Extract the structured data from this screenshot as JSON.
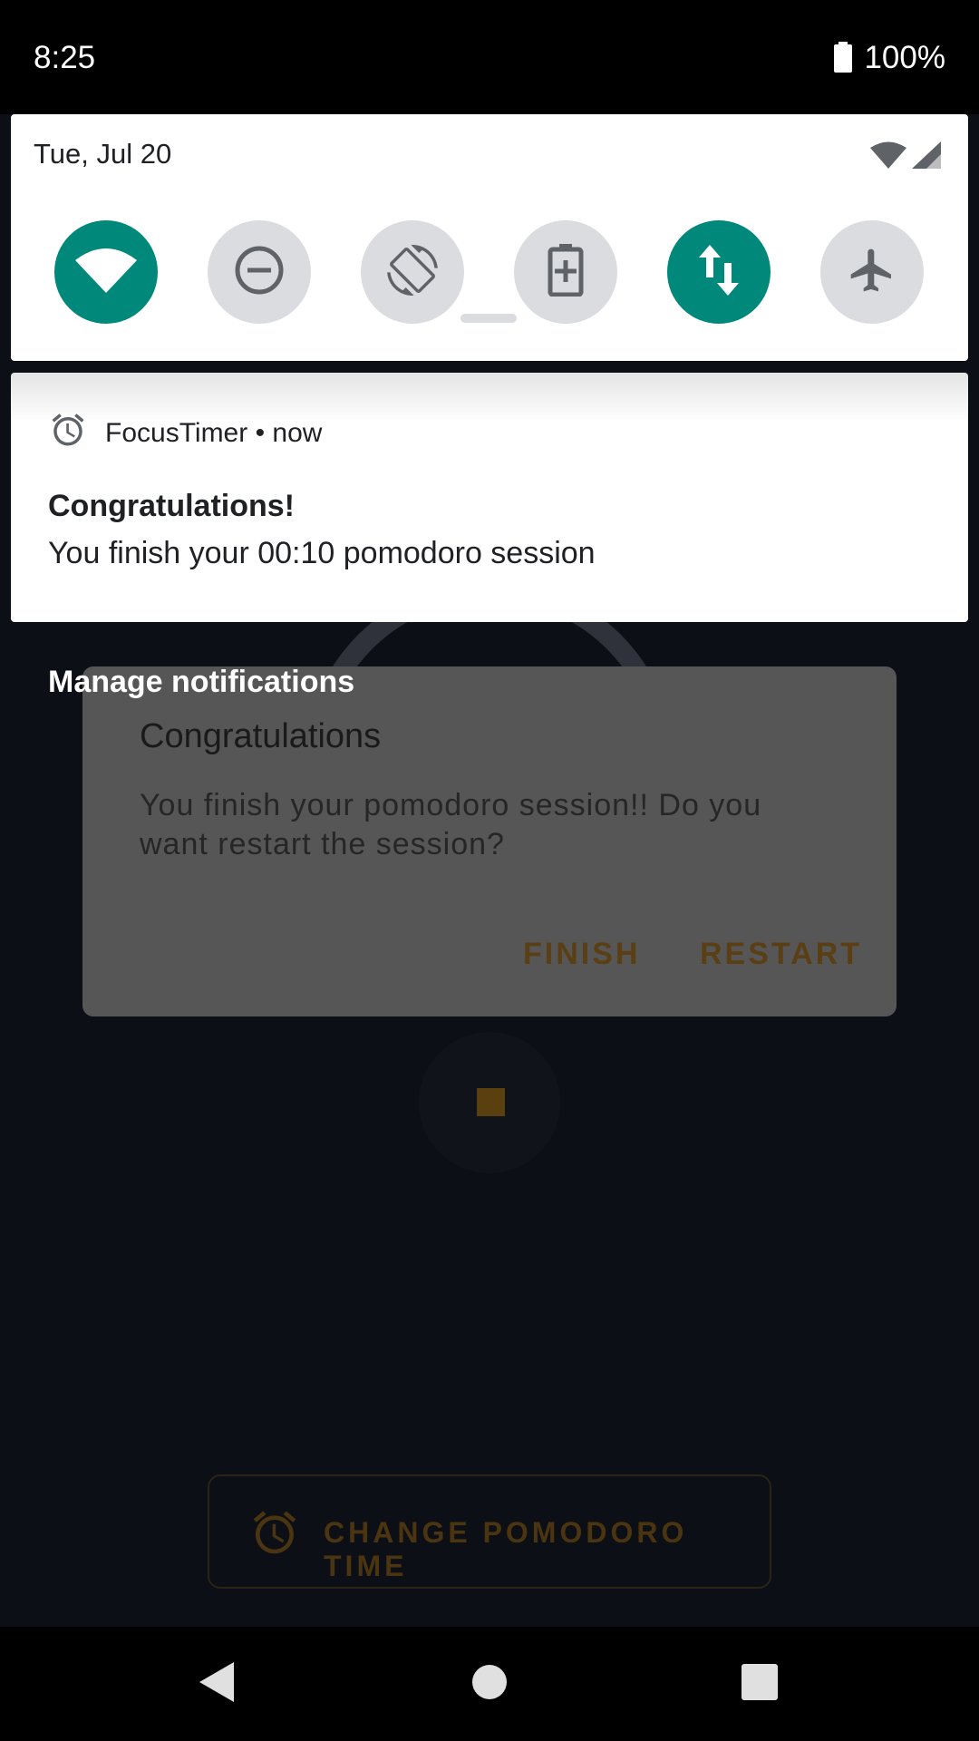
{
  "status_bar": {
    "time": "8:25",
    "battery": "100%"
  },
  "quick_settings": {
    "date": "Tue, Jul 20",
    "tiles": [
      {
        "name": "wifi",
        "icon": "wifi-icon",
        "state": "on"
      },
      {
        "name": "do-not-disturb",
        "icon": "minus-circle-icon",
        "state": "off"
      },
      {
        "name": "auto-rotate",
        "icon": "rotate-icon",
        "state": "off"
      },
      {
        "name": "battery-saver",
        "icon": "battery-plus-icon",
        "state": "off"
      },
      {
        "name": "mobile-data",
        "icon": "data-arrows-icon",
        "state": "on"
      },
      {
        "name": "airplane-mode",
        "icon": "airplane-icon",
        "state": "off"
      }
    ],
    "colors": {
      "on": "#00897b",
      "off": "#dadce0"
    }
  },
  "notification": {
    "app_line": "FocusTimer • now",
    "title": "Congratulations!",
    "text": "You finish your 00:10 pomodoro session"
  },
  "manage_notifications": "Manage notifications",
  "background_app": {
    "dialog": {
      "title": "Congratulations",
      "message": "You finish your pomodoro session!! Do you want restart the session?",
      "finish_label": "FINISH",
      "restart_label": "RESTART"
    },
    "change_button_label": "CHANGE POMODORO TIME",
    "accent_color": "#e69a1e"
  },
  "nav_bar": {
    "back": "back-icon",
    "home": "home-icon",
    "recents": "recents-icon"
  }
}
